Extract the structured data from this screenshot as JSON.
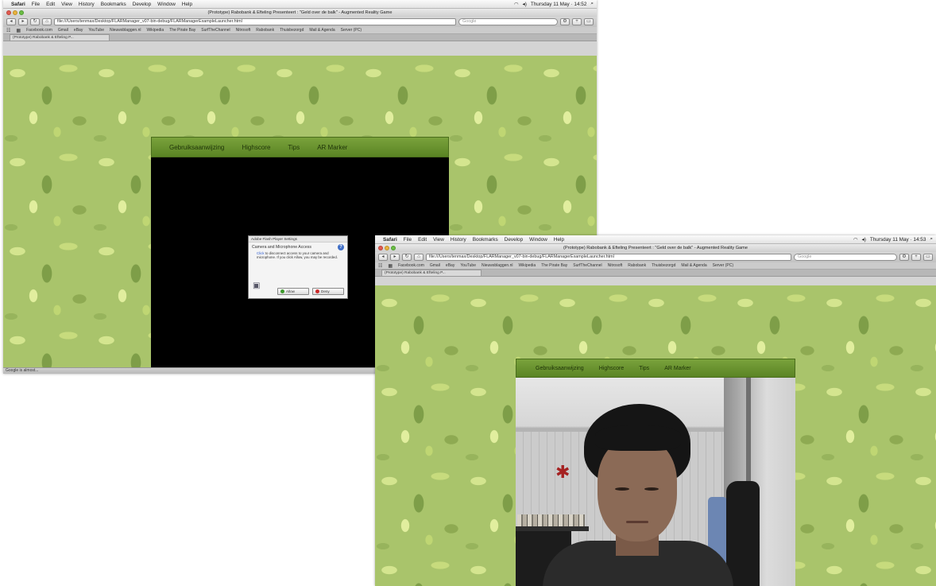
{
  "window_a": {
    "menubar": {
      "apple": "",
      "items": [
        "Safari",
        "File",
        "Edit",
        "View",
        "History",
        "Bookmarks",
        "Develop",
        "Window",
        "Help"
      ],
      "status": "Thursday 11 May · 14:52"
    },
    "title": "(Prototype) Rabobank & Efteling Presenteert : \"Geld over de balk\" - Augmented Reality Game",
    "url": "file:///Users/tenmax/Desktop/FLARManager_v07-bin-debug/FLARManagerExampleLauncher.html",
    "search_placeholder": "Google",
    "bookmarks": [
      "Facebook.com",
      "Gmail",
      "eBay",
      "YouTube",
      "Nieuwsblaggen.nl",
      "Wikipedia",
      "The Pirate Bay",
      "SurfTheChannel",
      "Nitrosoft",
      "Rabobank",
      "Thuisbezorgd",
      "Mail & Agenda",
      "Server (PC)"
    ],
    "tab_label": "(Prototype) Rabobank & Efteling P...",
    "status_text": "Google is almost...",
    "nav": [
      "Gebruiksaanwijzing",
      "Highscore",
      "Tips",
      "AR Marker"
    ],
    "flash_dialog": {
      "title": "Adobe Flash Player Settings",
      "heading": "Camera and Microphone Access",
      "text_link": "Click",
      "text": "to disconnect access to your camera and microphone. If you click Allow, you may be recorded.",
      "allow": "Allow",
      "deny": "Deny"
    }
  },
  "window_b": {
    "menubar": {
      "apple": "",
      "items": [
        "Safari",
        "File",
        "Edit",
        "View",
        "History",
        "Bookmarks",
        "Develop",
        "Window",
        "Help"
      ],
      "status": "Thursday 11 May · 14:53"
    },
    "title": "(Prototype) Rabobank & Efteling Presenteert : \"Geld over de balk\" - Augmented Reality Game",
    "url": "file:///Users/tenmax/Desktop/FLARManager_v07-bin-debug/FLARManagerExampleLauncher.html",
    "search_placeholder": "Google",
    "bookmarks": [
      "Facebook.com",
      "Gmail",
      "eBay",
      "YouTube",
      "Nieuwsblaggen.nl",
      "Wikipedia",
      "The Pirate Bay",
      "SurfTheChannel",
      "Nitrosoft",
      "Rabobank",
      "Thuisbezorgd",
      "Mail & Agenda",
      "Server (PC)"
    ],
    "tab_label": "(Prototype) Rabobank & Efteling P...",
    "nav": [
      "Gebruiksaanwijzing",
      "Highscore",
      "Tips",
      "AR Marker"
    ]
  }
}
